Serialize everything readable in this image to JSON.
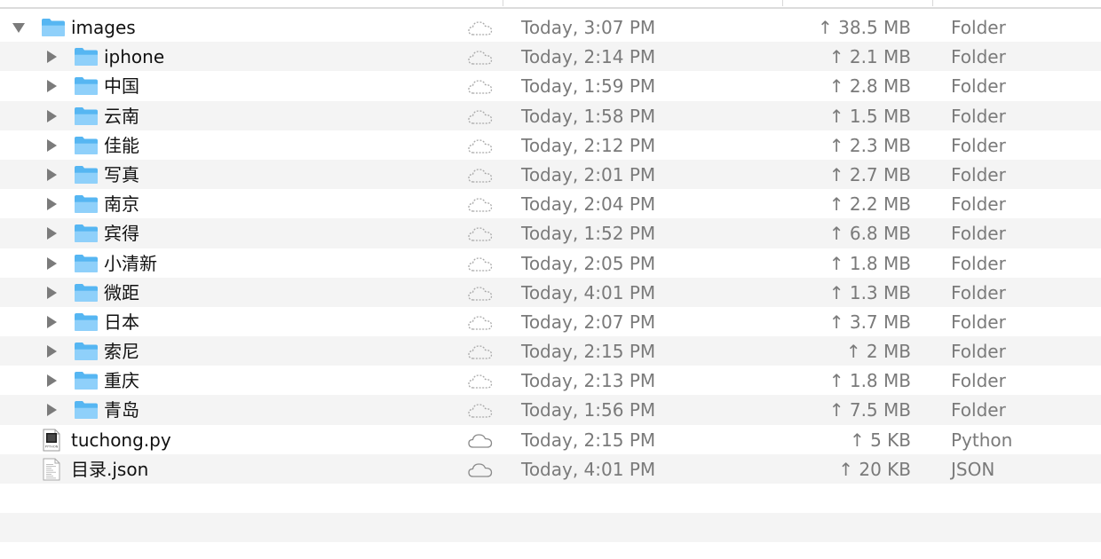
{
  "colors": {
    "folder": "#56b6f2",
    "folder_tab": "#8fd0fa",
    "text_primary": "#111111",
    "text_secondary": "#7a7a7a",
    "row_stripe": "#f4f4f4",
    "disclosure": "#7b7b7b"
  },
  "rows": [
    {
      "name": "images",
      "type": "folder",
      "expanded": true,
      "indent": 0,
      "cloud_icon": "cloud-dashed-icon",
      "date": "Today, 3:07 PM",
      "size": "↑ 38.5 MB",
      "kind": "Folder"
    },
    {
      "name": "iphone",
      "type": "folder",
      "expanded": false,
      "indent": 1,
      "cloud_icon": "cloud-dashed-icon",
      "date": "Today, 2:14 PM",
      "size": "↑ 2.1 MB",
      "kind": "Folder"
    },
    {
      "name": "中国",
      "type": "folder",
      "expanded": false,
      "indent": 1,
      "cloud_icon": "cloud-dashed-icon",
      "date": "Today, 1:59 PM",
      "size": "↑ 2.8 MB",
      "kind": "Folder"
    },
    {
      "name": "云南",
      "type": "folder",
      "expanded": false,
      "indent": 1,
      "cloud_icon": "cloud-dashed-icon",
      "date": "Today, 1:58 PM",
      "size": "↑ 1.5 MB",
      "kind": "Folder"
    },
    {
      "name": "佳能",
      "type": "folder",
      "expanded": false,
      "indent": 1,
      "cloud_icon": "cloud-dashed-icon",
      "date": "Today, 2:12 PM",
      "size": "↑ 2.3 MB",
      "kind": "Folder"
    },
    {
      "name": "写真",
      "type": "folder",
      "expanded": false,
      "indent": 1,
      "cloud_icon": "cloud-dashed-icon",
      "date": "Today, 2:01 PM",
      "size": "↑ 2.7 MB",
      "kind": "Folder"
    },
    {
      "name": "南京",
      "type": "folder",
      "expanded": false,
      "indent": 1,
      "cloud_icon": "cloud-dashed-icon",
      "date": "Today, 2:04 PM",
      "size": "↑ 2.2 MB",
      "kind": "Folder"
    },
    {
      "name": "宾得",
      "type": "folder",
      "expanded": false,
      "indent": 1,
      "cloud_icon": "cloud-dashed-icon",
      "date": "Today, 1:52 PM",
      "size": "↑ 6.8 MB",
      "kind": "Folder"
    },
    {
      "name": "小清新",
      "type": "folder",
      "expanded": false,
      "indent": 1,
      "cloud_icon": "cloud-dashed-icon",
      "date": "Today, 2:05 PM",
      "size": "↑ 1.8 MB",
      "kind": "Folder"
    },
    {
      "name": "微距",
      "type": "folder",
      "expanded": false,
      "indent": 1,
      "cloud_icon": "cloud-dashed-icon",
      "date": "Today, 4:01 PM",
      "size": "↑ 1.3 MB",
      "kind": "Folder"
    },
    {
      "name": "日本",
      "type": "folder",
      "expanded": false,
      "indent": 1,
      "cloud_icon": "cloud-dashed-icon",
      "date": "Today, 2:07 PM",
      "size": "↑ 3.7 MB",
      "kind": "Folder"
    },
    {
      "name": "索尼",
      "type": "folder",
      "expanded": false,
      "indent": 1,
      "cloud_icon": "cloud-dashed-icon",
      "date": "Today, 2:15 PM",
      "size": "↑ 2 MB",
      "kind": "Folder"
    },
    {
      "name": "重庆",
      "type": "folder",
      "expanded": false,
      "indent": 1,
      "cloud_icon": "cloud-dashed-icon",
      "date": "Today, 2:13 PM",
      "size": "↑ 1.8 MB",
      "kind": "Folder"
    },
    {
      "name": "青岛",
      "type": "folder",
      "expanded": false,
      "indent": 1,
      "cloud_icon": "cloud-dashed-icon",
      "date": "Today, 1:56 PM",
      "size": "↑ 7.5 MB",
      "kind": "Folder"
    },
    {
      "name": "tuchong.py",
      "type": "python",
      "indent": 0,
      "cloud_icon": "cloud-icon",
      "date": "Today, 2:15 PM",
      "size": "↑ 5 KB",
      "kind": "Python",
      "icon_label": "PYTHON"
    },
    {
      "name": "目录.json",
      "type": "json",
      "indent": 0,
      "cloud_icon": "cloud-icon",
      "date": "Today, 4:01 PM",
      "size": "↑ 20 KB",
      "kind": "JSON"
    }
  ],
  "empty_rows": 3
}
